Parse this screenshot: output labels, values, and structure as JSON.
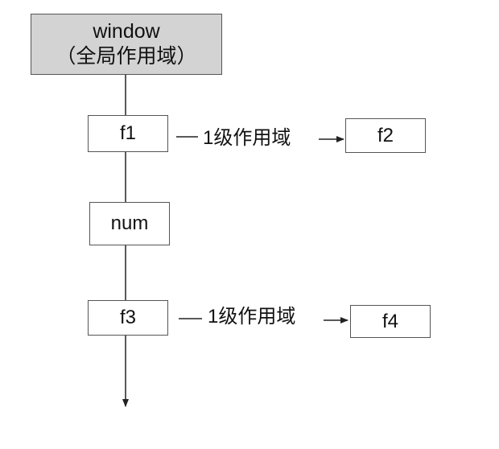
{
  "diagram": {
    "root": {
      "line1": "window",
      "line2": "（全局作用域）"
    },
    "chain": [
      {
        "id": "f1",
        "label": "f1"
      },
      {
        "id": "num",
        "label": "num"
      },
      {
        "id": "f3",
        "label": "f3"
      }
    ],
    "branches": [
      {
        "from": "f1",
        "label": "1级作用域",
        "target": "f2"
      },
      {
        "from": "f3",
        "label": "1级作用域",
        "target": "f4"
      }
    ]
  },
  "colors": {
    "root_fill": "#d3d3d3",
    "border": "#555555",
    "line": "#222222"
  }
}
